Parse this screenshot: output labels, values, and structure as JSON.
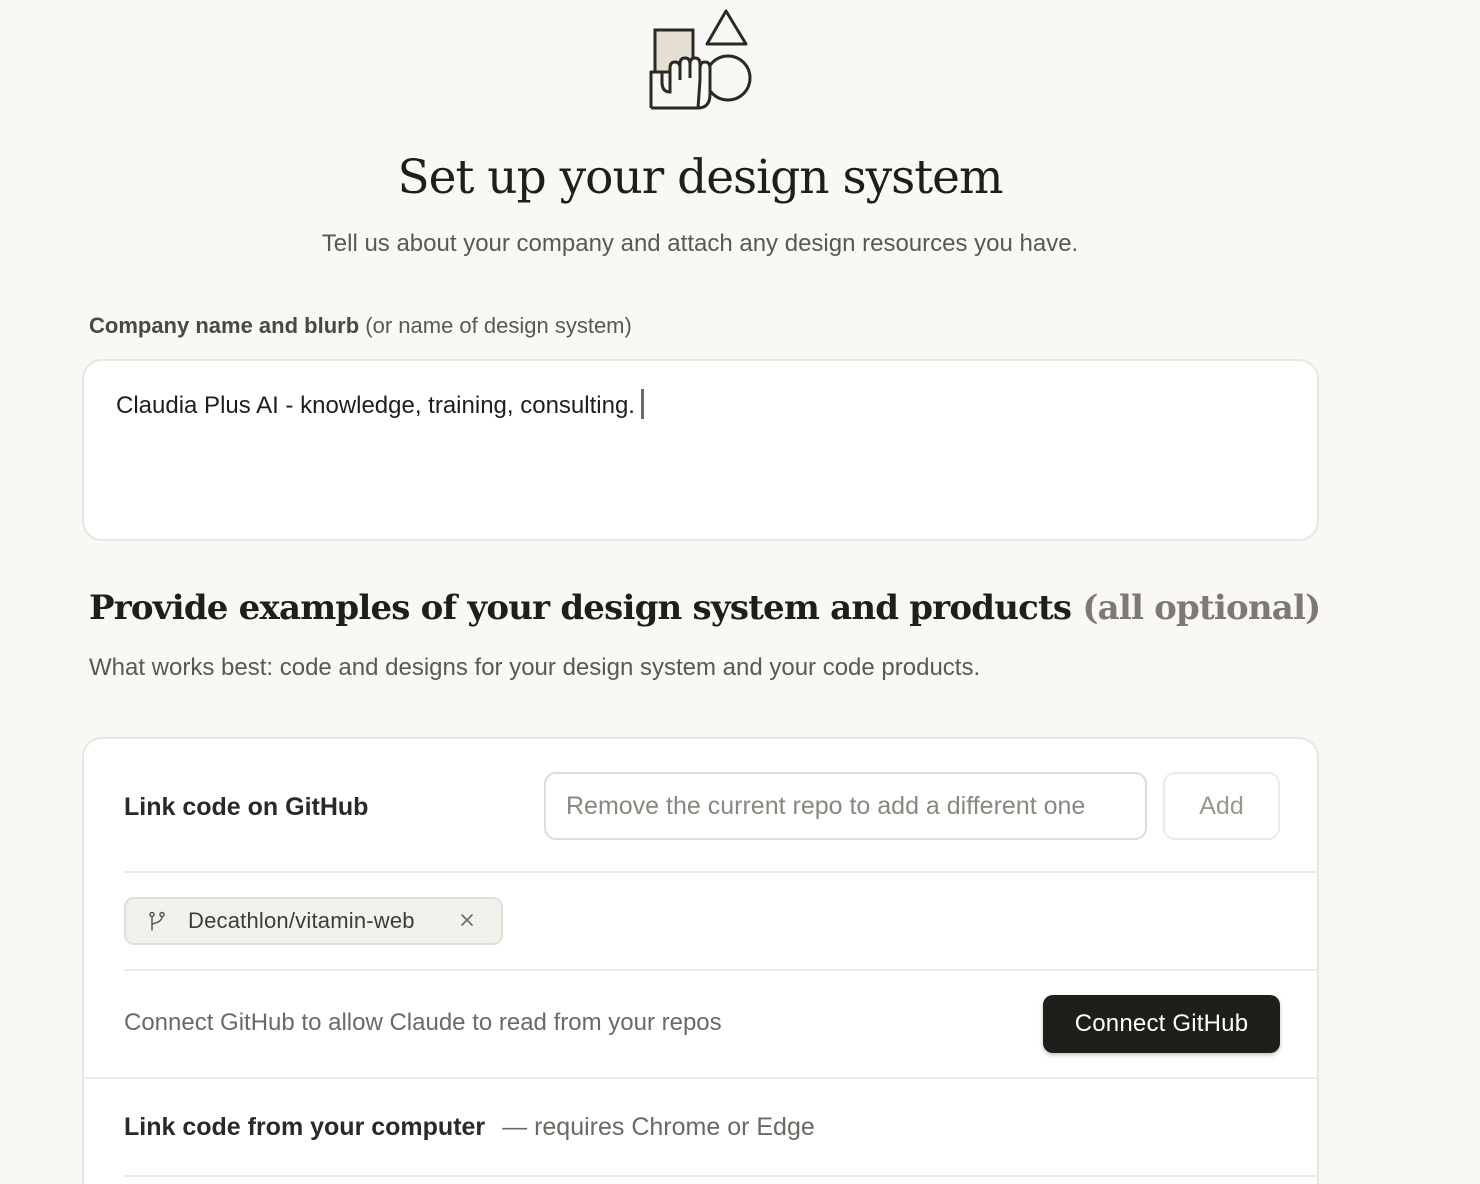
{
  "header": {
    "title": "Set up your design system",
    "subtitle": "Tell us about your company and attach any design resources you have."
  },
  "company": {
    "label_strong": "Company name and blurb",
    "label_note": "(or name of design system)",
    "value": "Claudia Plus AI - knowledge, training, consulting."
  },
  "examples": {
    "title": "Provide examples of your design system and products",
    "title_note": "(all optional)",
    "subtitle": "What works best: code and designs for your design system and your code products."
  },
  "github": {
    "title": "Link code on GitHub",
    "input_placeholder": "Remove the current repo to add a different one",
    "add_label": "Add",
    "repos": [
      "Decathlon/vitamin-web"
    ],
    "connect_text": "Connect GitHub to allow Claude to read from your repos",
    "connect_button": "Connect GitHub"
  },
  "local_code": {
    "title": "Link code from your computer",
    "note": "— requires Chrome or Edge"
  },
  "icons": {
    "hero": "shapes-hand-illustration",
    "repo": "git-branch-icon",
    "remove": "close-icon"
  }
}
